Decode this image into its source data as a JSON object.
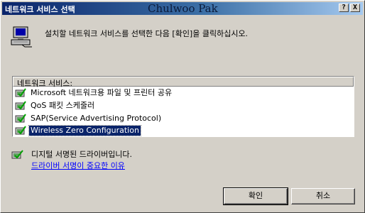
{
  "window": {
    "title": "네트워크 서비스 선택",
    "watermark": "Chulwoo Pak",
    "help_label": "?",
    "close_label": "X",
    "accent_color": "#0a246a"
  },
  "instruction": "설치할 네트워크 서비스를 선택한 다음 [확인]을 클릭하십시오.",
  "list": {
    "header": "네트워크 서비스:",
    "items": [
      {
        "label": "Microsoft 네트워크용 파일 및 프린터 공유",
        "icon": "network-service-icon",
        "selected": false
      },
      {
        "label": "QoS 패킷 스케줄러",
        "icon": "network-service-icon",
        "selected": false
      },
      {
        "label": "SAP(Service Advertising Protocol)",
        "icon": "network-service-icon",
        "selected": false
      },
      {
        "label": "Wireless Zero Configuration",
        "icon": "network-service-icon",
        "selected": true
      }
    ]
  },
  "signature": {
    "text": "디지털 서명된 드라이버입니다.",
    "link": "드라이버 서명이 중요한 이유",
    "icon": "signed-driver-icon"
  },
  "buttons": {
    "ok": "확인",
    "cancel": "취소"
  }
}
